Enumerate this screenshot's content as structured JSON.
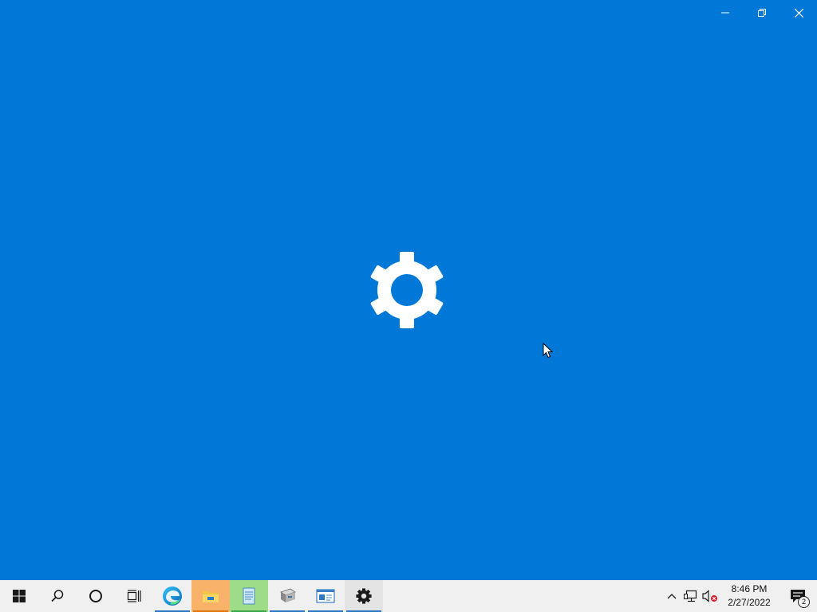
{
  "splash": {
    "app_icon": "gear-icon",
    "background_color": "#0078d7"
  },
  "window_controls": {
    "minimize_icon": "minimize-icon",
    "restore_icon": "restore-icon",
    "close_icon": "close-icon"
  },
  "taskbar": {
    "items": [
      {
        "icon": "windows-start-icon"
      },
      {
        "icon": "search-icon"
      },
      {
        "icon": "cortana-icon"
      },
      {
        "icon": "task-view-icon"
      },
      {
        "icon": "edge-browser-icon"
      },
      {
        "icon": "file-explorer-icon"
      },
      {
        "icon": "notepad-icon"
      },
      {
        "icon": "printer-app-icon"
      },
      {
        "icon": "control-panel-icon"
      },
      {
        "icon": "settings-gear-icon"
      }
    ],
    "tray": {
      "chevron_icon": "chevron-up-icon",
      "network_icon": "network-icon",
      "volume_icon": "volume-muted-icon",
      "time": "8:46 PM",
      "date": "2/27/2022",
      "notification_icon": "action-center-icon",
      "notification_count": "2"
    }
  }
}
